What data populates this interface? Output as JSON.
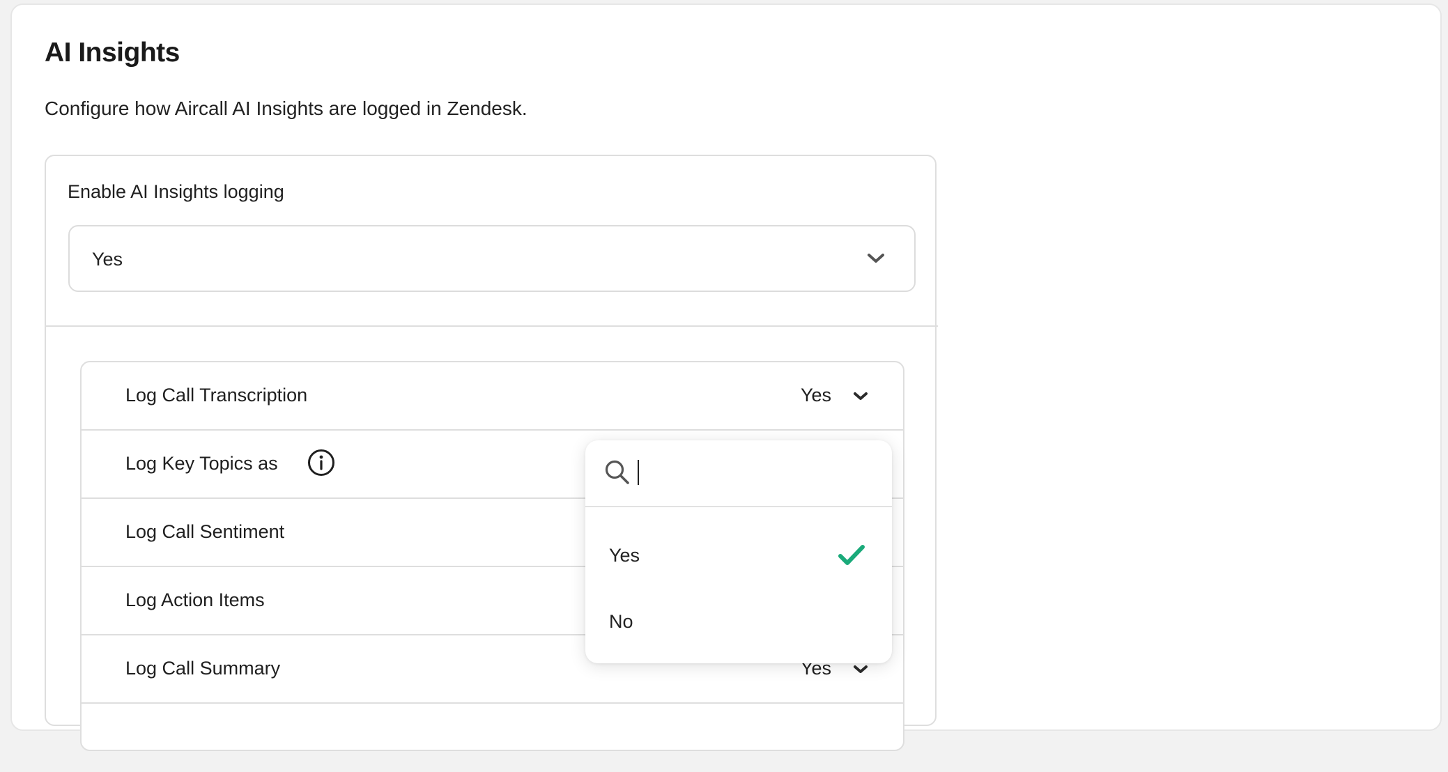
{
  "section": {
    "title": "AI Insights",
    "description": "Configure how Aircall AI Insights are logged in Zendesk."
  },
  "enable_logging": {
    "label": "Enable AI Insights logging",
    "value": "Yes"
  },
  "settings": [
    {
      "label": "Log Call Transcription",
      "value": "Yes"
    },
    {
      "label": "Log Key Topics as",
      "value": ""
    },
    {
      "label": "Log Call Sentiment",
      "value": ""
    },
    {
      "label": "Log Action Items",
      "value": ""
    },
    {
      "label": "Log Call Summary",
      "value": "Yes"
    }
  ],
  "dropdown": {
    "search_value": "",
    "options": [
      {
        "label": "Yes",
        "selected": true
      },
      {
        "label": "No",
        "selected": false
      }
    ]
  },
  "colors": {
    "check": "#1aaa7a",
    "icon": "#555555"
  }
}
